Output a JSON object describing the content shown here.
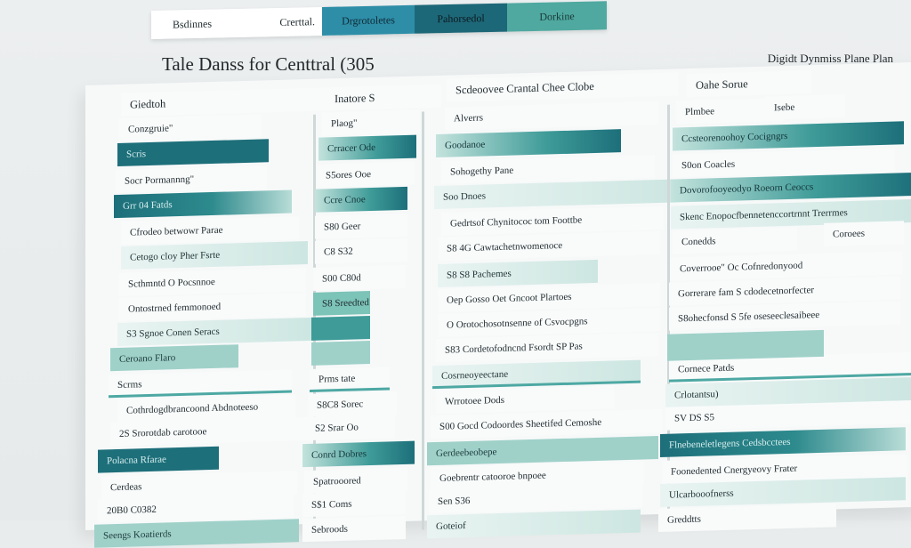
{
  "tabs": [
    {
      "label": "Bsdinnes"
    },
    {
      "label": "Crerttal."
    },
    {
      "label": "Drgrotoletes"
    },
    {
      "label": "Pahorsedol"
    },
    {
      "label": "Dorkine"
    }
  ],
  "title": "Tale Danss for Centtral (305",
  "subtitle": "Digidt Dynmiss Plane Plan",
  "col1": {
    "header": "Giedtoh",
    "rows": [
      "Conzgruie\"",
      "Scris",
      "Socr Pormannng\"",
      "Grr 04 Fatds",
      "Cfrodeo betwowr Parae",
      "Cetogo cloy Pher Fsrte",
      "Scthmntd O Pocsnnoe",
      "Ontostrned femmonoed",
      "S3 Sgnoe Conen Seracs",
      "Ceroano Flaro",
      "Scrms",
      "Cothrdogdbrancoond Abdnoteeso",
      "2S Srorotdab carotooe",
      "Polacna Rfarae",
      "Cerdeas",
      "20B0 C0382",
      "Seengs Koatierds"
    ]
  },
  "col2": {
    "header": "Inatore S",
    "rows": [
      "Plaog\"",
      "Crracer Ode",
      "S5ores Ooe",
      "Ccre Cnoe",
      "S80 Geer",
      "C8 S32",
      "S00 C80d",
      "S8 Sreedted",
      "",
      "",
      "Prms tate",
      "S8C8 Sorec",
      "S2 Srar Oo",
      "Conrd Dobres",
      "Spatrooored",
      "S$1 Coms",
      "Sebroods"
    ]
  },
  "col3": {
    "header": "Scdeoovee Crantal Chee Clobe",
    "rows": [
      "Alverrs",
      "Goodanoe",
      "Sohogethy Pane",
      "Soo Dnoes",
      "Gedrtsof Chynitococ tom Foottbe",
      "S8 4G Cawtachetnwomenoce",
      "S8 S8 Pachemes",
      "Oep Gosso Oet Gncoot Plartoes",
      "O Orotochosotnsenne of Csvocpgns",
      "S83 Cordetofodncnd Fsordt SP Pas",
      "Cosrneoyeectane",
      "Wrrotoee Dods",
      "S00 Gocd Codoordes Sheetifed Cemoshe",
      "Gerdeebeobepe",
      "Goebrentr catooroe bnpoee",
      "Sen S36",
      "Goteiof"
    ]
  },
  "col4": {
    "header": "Oahe Sorue",
    "subheader_a": "Plmbee",
    "subheader_b": "Isebe",
    "rows": [
      "Ccsteorenoohoy Cocigngrs",
      "S0on Coacles",
      "Dovorofooyeodyo Roeorn Ceoccs",
      "Skenc Enopocfbennetenccortrnnt Trerrmes",
      "Conedds",
      "Coroees",
      "Coverrooe\" Oc Cofnredonyood",
      "Gorrerare fam S cdodecetnorfecter",
      "S8ohecfonsd S 5fe oseseeclesaibeee",
      "Cornece Patds",
      "Crlotantsu)",
      "SV DS S5",
      "Flnebeneletlegens Cedsbcctees",
      "Foonedented Cnergyeovy Frater",
      "Ulcarbooofnerss",
      "Greddtts"
    ]
  },
  "colors": {
    "dark_teal": "#1d6f7a",
    "mid_teal": "#3e9b98",
    "light_teal": "#9fd1c9",
    "tab_blue": "#2e8ea8"
  }
}
